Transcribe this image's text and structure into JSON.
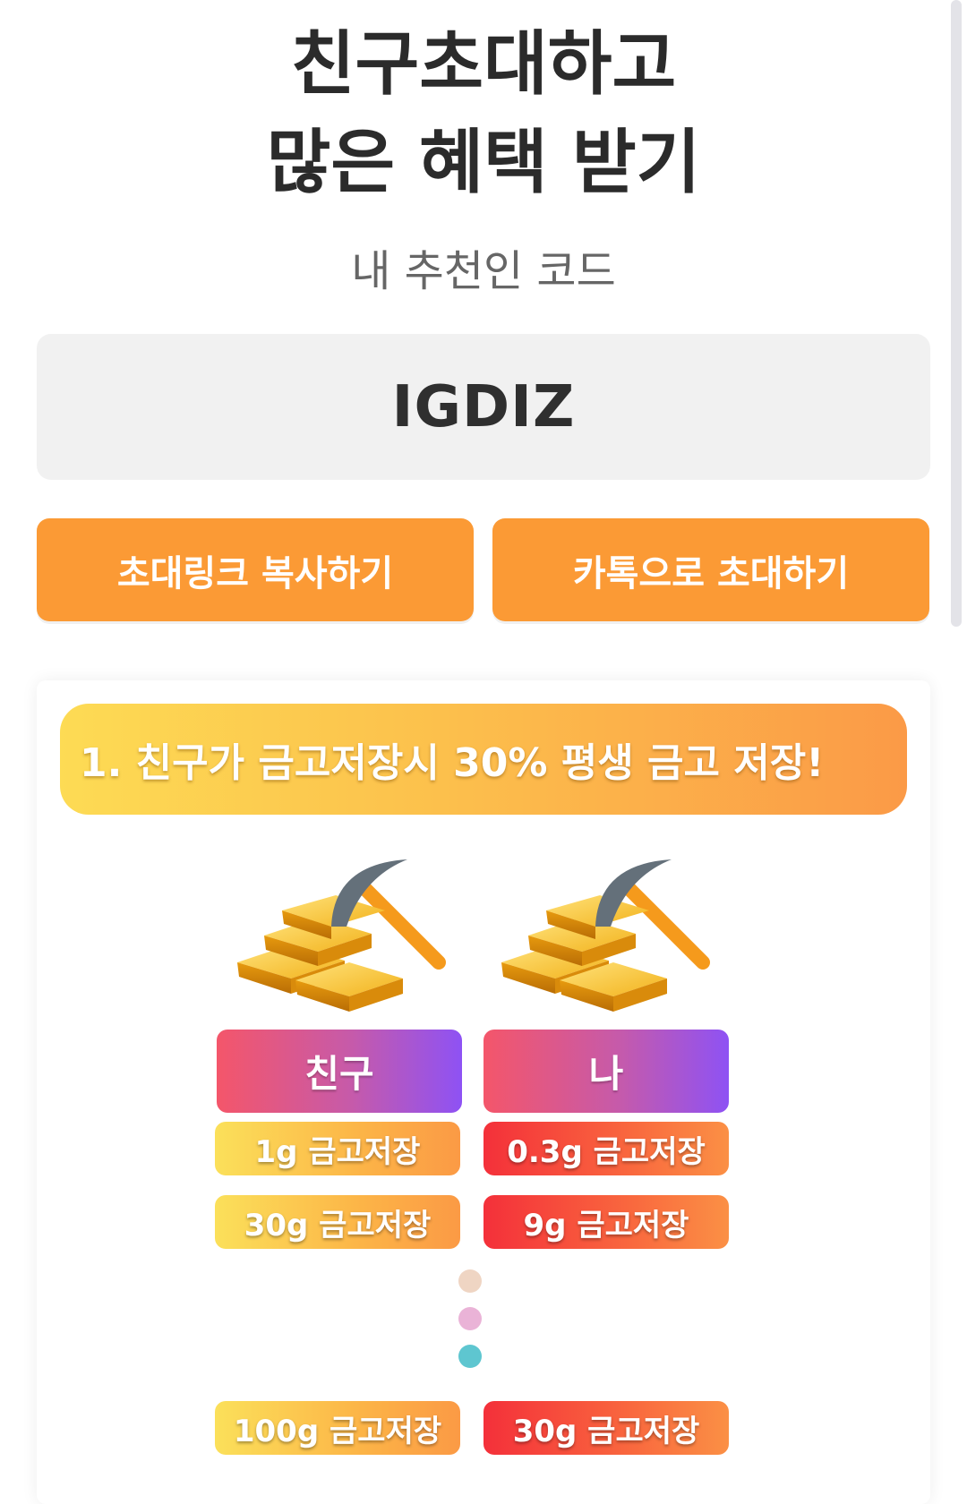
{
  "header": {
    "title_line1": "친구초대하고",
    "title_line2": "많은 혜택 받기",
    "subtitle": "내 추천인 코드"
  },
  "referral": {
    "code": "IGDIZ"
  },
  "buttons": {
    "copy_link": "초대링크 복사하기",
    "kakao_invite": "카톡으로 초대하기"
  },
  "benefit": {
    "banner": "1. 친구가 금고저장시 30% 평생 금고 저장!",
    "columns": {
      "friend": "친구",
      "me": "나"
    },
    "rows": [
      {
        "friend": "1g 금고저장",
        "me": "0.3g 금고저장"
      },
      {
        "friend": "30g 금고저장",
        "me": "9g 금고저장"
      },
      {
        "friend": "100g 금고저장",
        "me": "30g 금고저장"
      }
    ],
    "dot_colors": [
      "#efd5c3",
      "#eab3d7",
      "#5ec6d0"
    ]
  },
  "colors": {
    "accent_orange": "#fb9a35",
    "code_box_bg": "#f1f1f1",
    "title_text": "#2b2b2b"
  },
  "icons": {
    "gold_icon": "gold-bars-with-pickaxe-icon"
  }
}
